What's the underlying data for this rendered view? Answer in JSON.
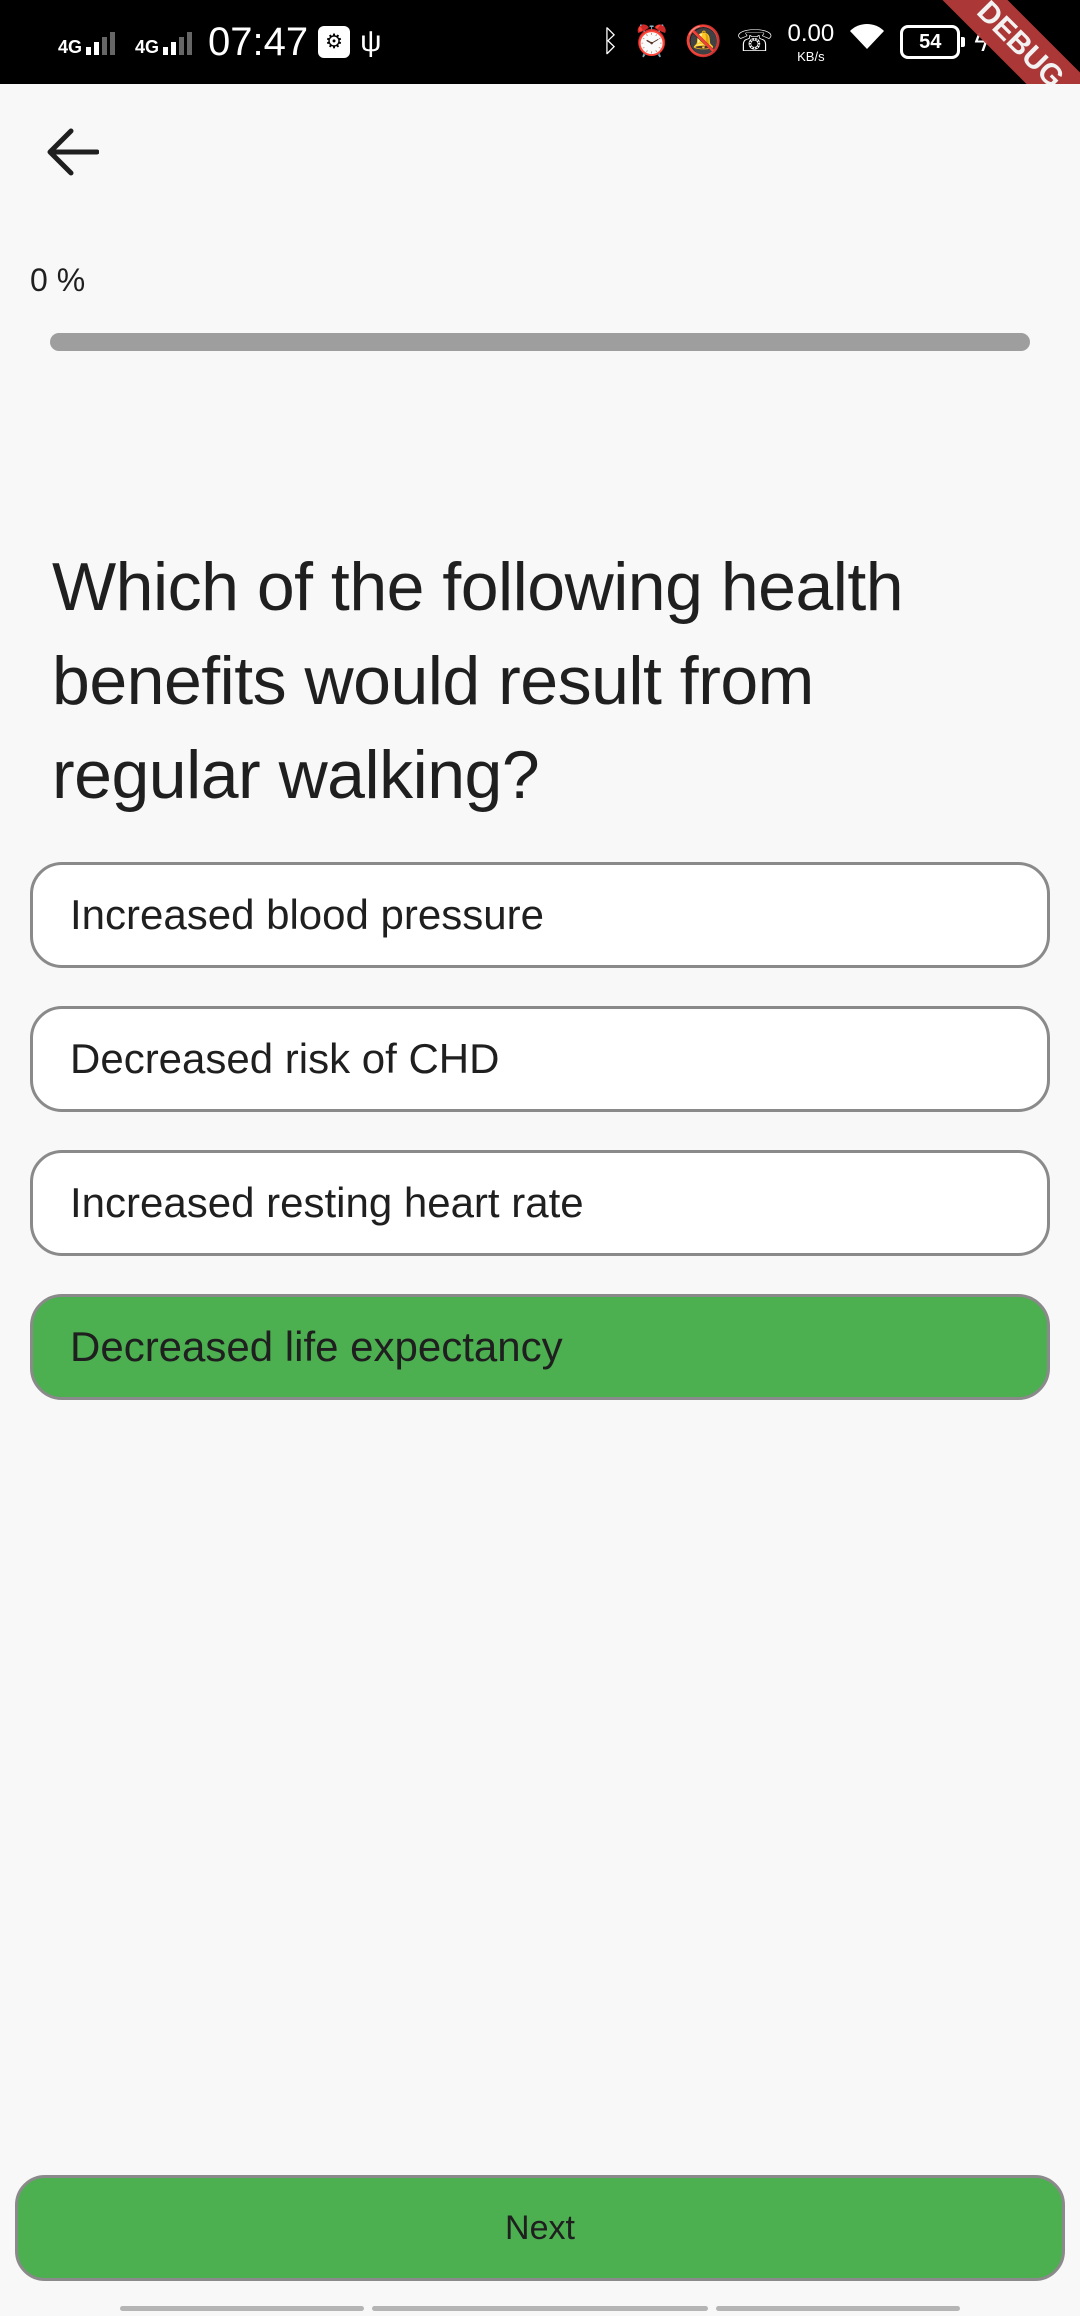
{
  "status_bar": {
    "network_1": "4G",
    "network_2": "4G",
    "time": "07:47",
    "speed_value": "0.00",
    "speed_unit": "KB/s",
    "battery": "54",
    "debug_banner": "DEBUG"
  },
  "header": {
    "back_icon": "arrow-left-icon"
  },
  "progress": {
    "label": "0 %",
    "value": 0,
    "track_color": "#9e9e9e",
    "fill_color": "#4caf50"
  },
  "question": {
    "text": "Which of the following health benefits would result from regular walking?"
  },
  "options": [
    {
      "label": "Increased blood pressure",
      "selected": false
    },
    {
      "label": "Decreased risk of CHD",
      "selected": false
    },
    {
      "label": "Increased resting heart rate",
      "selected": false
    },
    {
      "label": "Decreased life expectancy",
      "selected": true
    }
  ],
  "colors": {
    "accent": "#4caf50",
    "option_border": "#8a8a8a",
    "background": "#f8f8f8"
  },
  "footer": {
    "next_label": "Next"
  }
}
